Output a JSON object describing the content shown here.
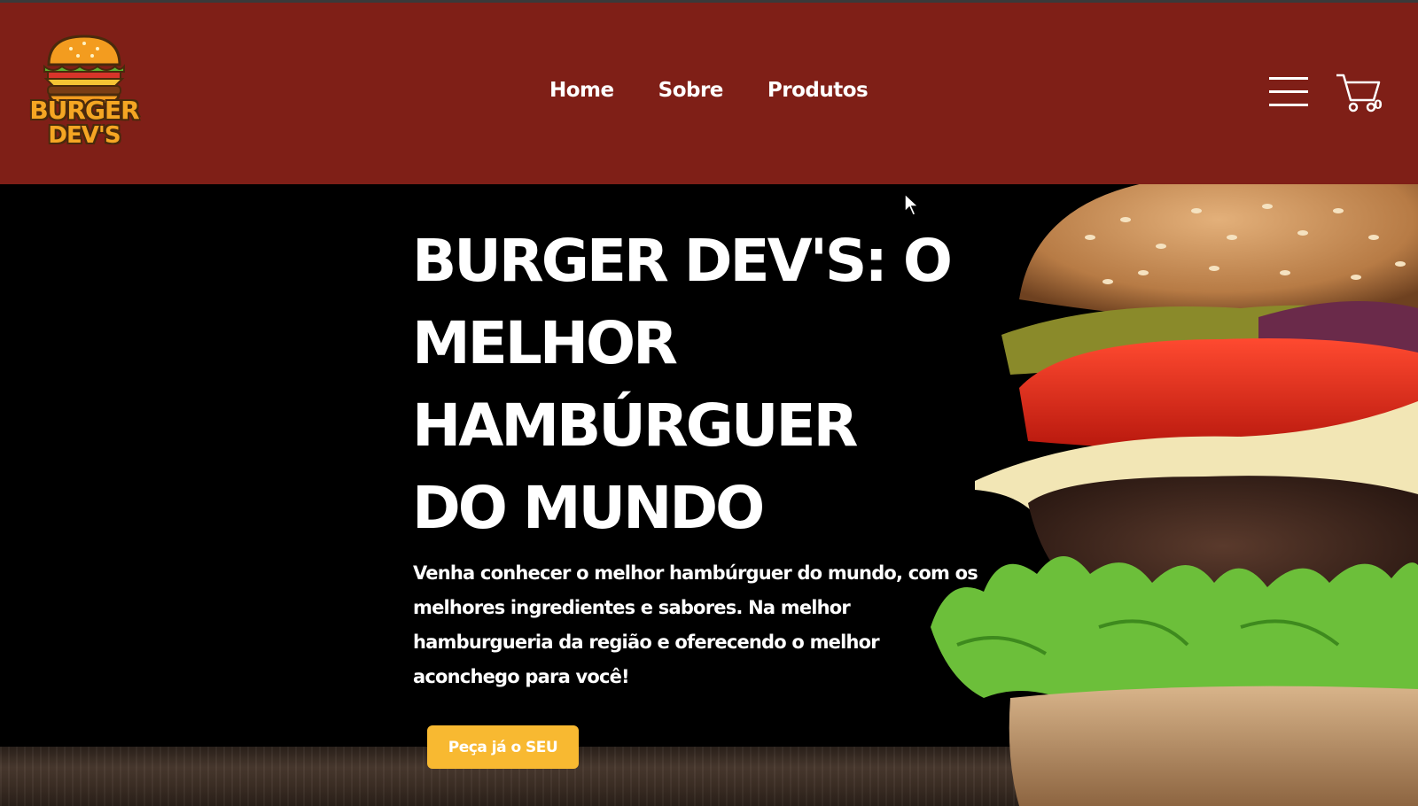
{
  "brand": {
    "logo_line1": "BURGER",
    "logo_line2": "DEV'S",
    "logo_color": "#f5a623"
  },
  "header": {
    "background": "#7f1f17",
    "nav": [
      {
        "label": "Home"
      },
      {
        "label": "Sobre"
      },
      {
        "label": "Produtos"
      }
    ],
    "menu_icon": "hamburger-menu-icon",
    "cart_icon": "shopping-cart-icon",
    "cart_count": "0"
  },
  "hero": {
    "title": "BURGER DEV'S: O MELHOR HAMBÚRGUER DO MUNDO",
    "description": "Venha conhecer o melhor hambúrguer do mundo, com os melhores ingredientes e sabores. Na melhor hamburgueria da região e oferecendo o melhor aconchego para você!",
    "cta_label": "Peça já o SEU",
    "cta_color": "#f8b931",
    "image": "burger-photo"
  }
}
